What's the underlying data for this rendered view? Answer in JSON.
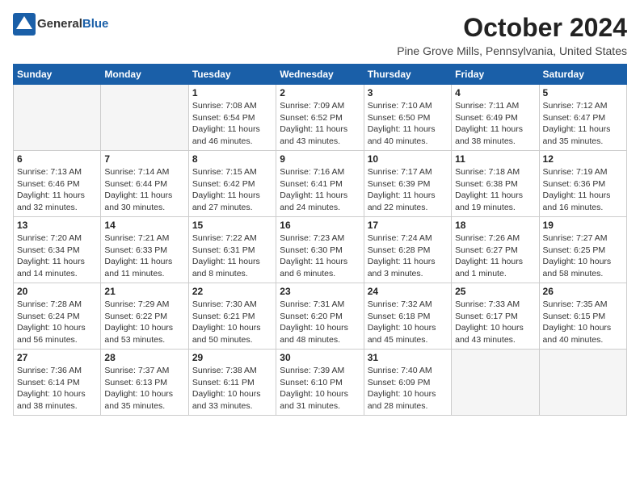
{
  "header": {
    "logo_general": "General",
    "logo_blue": "Blue",
    "month_title": "October 2024",
    "location": "Pine Grove Mills, Pennsylvania, United States"
  },
  "weekdays": [
    "Sunday",
    "Monday",
    "Tuesday",
    "Wednesday",
    "Thursday",
    "Friday",
    "Saturday"
  ],
  "weeks": [
    [
      {
        "day": "",
        "info": ""
      },
      {
        "day": "",
        "info": ""
      },
      {
        "day": "1",
        "info": "Sunrise: 7:08 AM\nSunset: 6:54 PM\nDaylight: 11 hours and 46 minutes."
      },
      {
        "day": "2",
        "info": "Sunrise: 7:09 AM\nSunset: 6:52 PM\nDaylight: 11 hours and 43 minutes."
      },
      {
        "day": "3",
        "info": "Sunrise: 7:10 AM\nSunset: 6:50 PM\nDaylight: 11 hours and 40 minutes."
      },
      {
        "day": "4",
        "info": "Sunrise: 7:11 AM\nSunset: 6:49 PM\nDaylight: 11 hours and 38 minutes."
      },
      {
        "day": "5",
        "info": "Sunrise: 7:12 AM\nSunset: 6:47 PM\nDaylight: 11 hours and 35 minutes."
      }
    ],
    [
      {
        "day": "6",
        "info": "Sunrise: 7:13 AM\nSunset: 6:46 PM\nDaylight: 11 hours and 32 minutes."
      },
      {
        "day": "7",
        "info": "Sunrise: 7:14 AM\nSunset: 6:44 PM\nDaylight: 11 hours and 30 minutes."
      },
      {
        "day": "8",
        "info": "Sunrise: 7:15 AM\nSunset: 6:42 PM\nDaylight: 11 hours and 27 minutes."
      },
      {
        "day": "9",
        "info": "Sunrise: 7:16 AM\nSunset: 6:41 PM\nDaylight: 11 hours and 24 minutes."
      },
      {
        "day": "10",
        "info": "Sunrise: 7:17 AM\nSunset: 6:39 PM\nDaylight: 11 hours and 22 minutes."
      },
      {
        "day": "11",
        "info": "Sunrise: 7:18 AM\nSunset: 6:38 PM\nDaylight: 11 hours and 19 minutes."
      },
      {
        "day": "12",
        "info": "Sunrise: 7:19 AM\nSunset: 6:36 PM\nDaylight: 11 hours and 16 minutes."
      }
    ],
    [
      {
        "day": "13",
        "info": "Sunrise: 7:20 AM\nSunset: 6:34 PM\nDaylight: 11 hours and 14 minutes."
      },
      {
        "day": "14",
        "info": "Sunrise: 7:21 AM\nSunset: 6:33 PM\nDaylight: 11 hours and 11 minutes."
      },
      {
        "day": "15",
        "info": "Sunrise: 7:22 AM\nSunset: 6:31 PM\nDaylight: 11 hours and 8 minutes."
      },
      {
        "day": "16",
        "info": "Sunrise: 7:23 AM\nSunset: 6:30 PM\nDaylight: 11 hours and 6 minutes."
      },
      {
        "day": "17",
        "info": "Sunrise: 7:24 AM\nSunset: 6:28 PM\nDaylight: 11 hours and 3 minutes."
      },
      {
        "day": "18",
        "info": "Sunrise: 7:26 AM\nSunset: 6:27 PM\nDaylight: 11 hours and 1 minute."
      },
      {
        "day": "19",
        "info": "Sunrise: 7:27 AM\nSunset: 6:25 PM\nDaylight: 10 hours and 58 minutes."
      }
    ],
    [
      {
        "day": "20",
        "info": "Sunrise: 7:28 AM\nSunset: 6:24 PM\nDaylight: 10 hours and 56 minutes."
      },
      {
        "day": "21",
        "info": "Sunrise: 7:29 AM\nSunset: 6:22 PM\nDaylight: 10 hours and 53 minutes."
      },
      {
        "day": "22",
        "info": "Sunrise: 7:30 AM\nSunset: 6:21 PM\nDaylight: 10 hours and 50 minutes."
      },
      {
        "day": "23",
        "info": "Sunrise: 7:31 AM\nSunset: 6:20 PM\nDaylight: 10 hours and 48 minutes."
      },
      {
        "day": "24",
        "info": "Sunrise: 7:32 AM\nSunset: 6:18 PM\nDaylight: 10 hours and 45 minutes."
      },
      {
        "day": "25",
        "info": "Sunrise: 7:33 AM\nSunset: 6:17 PM\nDaylight: 10 hours and 43 minutes."
      },
      {
        "day": "26",
        "info": "Sunrise: 7:35 AM\nSunset: 6:15 PM\nDaylight: 10 hours and 40 minutes."
      }
    ],
    [
      {
        "day": "27",
        "info": "Sunrise: 7:36 AM\nSunset: 6:14 PM\nDaylight: 10 hours and 38 minutes."
      },
      {
        "day": "28",
        "info": "Sunrise: 7:37 AM\nSunset: 6:13 PM\nDaylight: 10 hours and 35 minutes."
      },
      {
        "day": "29",
        "info": "Sunrise: 7:38 AM\nSunset: 6:11 PM\nDaylight: 10 hours and 33 minutes."
      },
      {
        "day": "30",
        "info": "Sunrise: 7:39 AM\nSunset: 6:10 PM\nDaylight: 10 hours and 31 minutes."
      },
      {
        "day": "31",
        "info": "Sunrise: 7:40 AM\nSunset: 6:09 PM\nDaylight: 10 hours and 28 minutes."
      },
      {
        "day": "",
        "info": ""
      },
      {
        "day": "",
        "info": ""
      }
    ]
  ]
}
